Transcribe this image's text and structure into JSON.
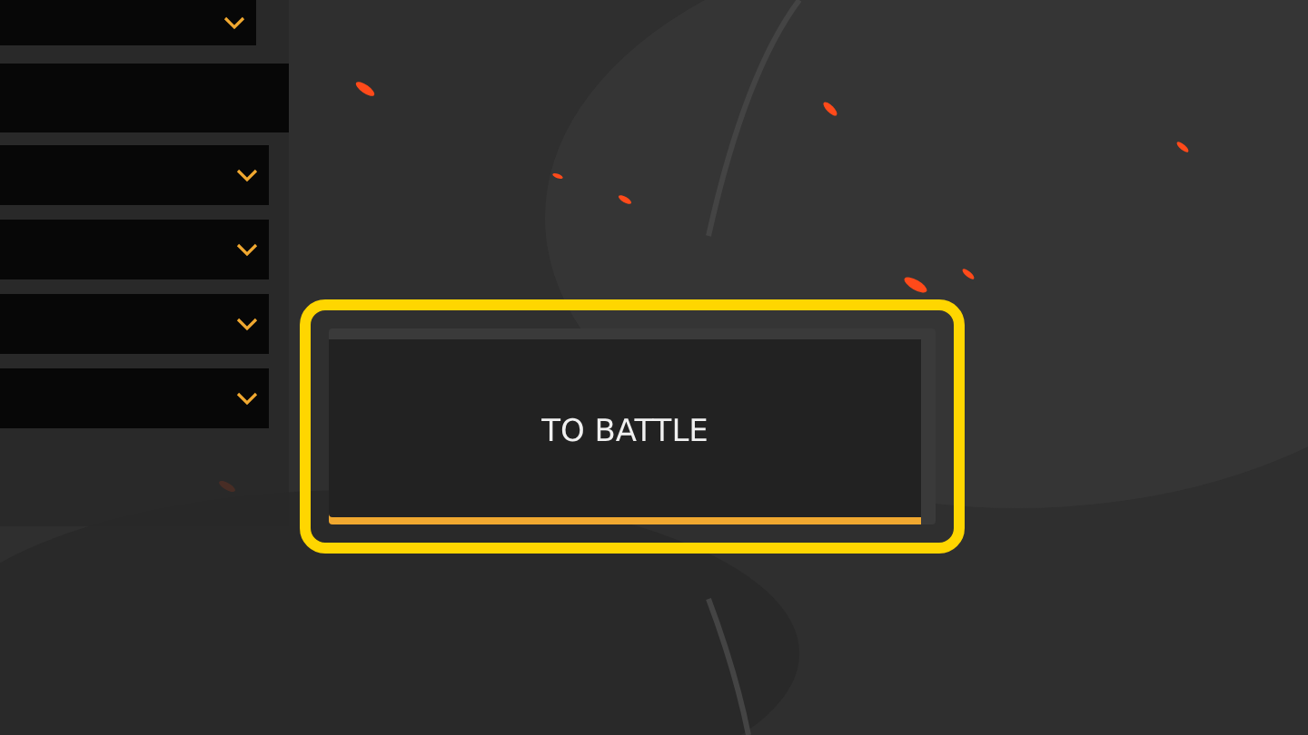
{
  "panel": {
    "rows": [
      {
        "kind": "dropdown"
      },
      {
        "kind": "blank"
      },
      {
        "kind": "dropdown"
      },
      {
        "kind": "dropdown"
      },
      {
        "kind": "dropdown"
      },
      {
        "kind": "dropdown"
      }
    ]
  },
  "battle_button": {
    "label": "TO BATTLE",
    "focused": true
  }
}
